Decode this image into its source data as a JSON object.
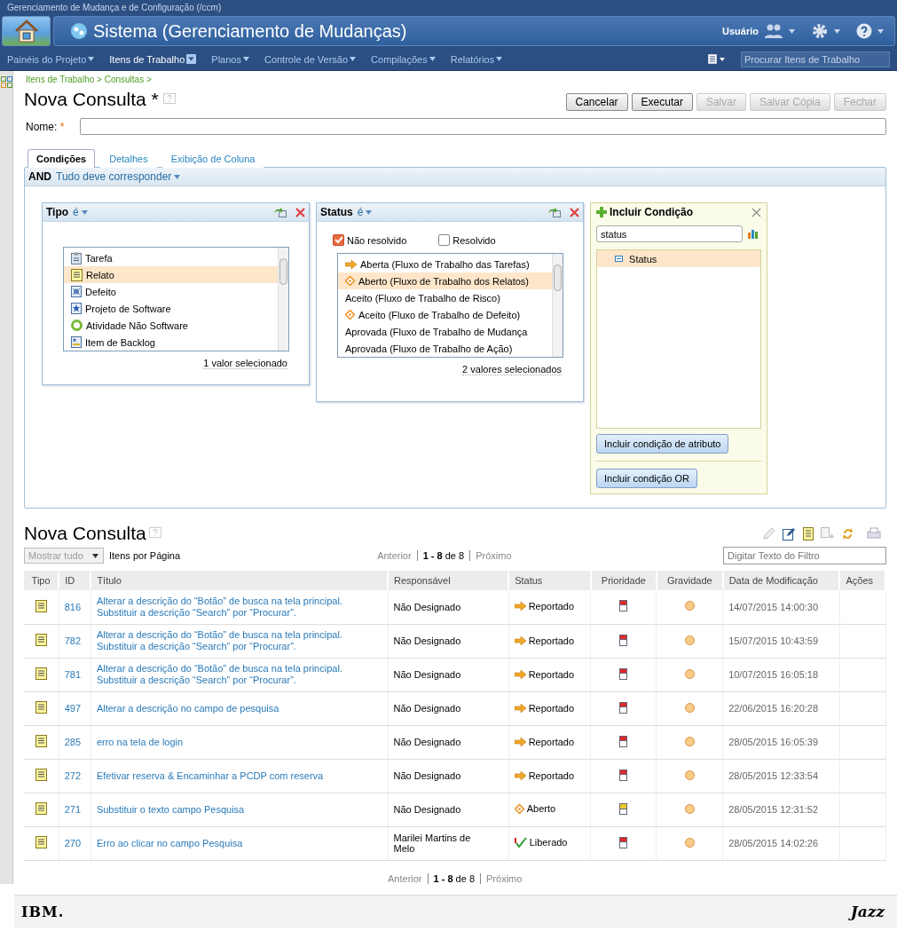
{
  "browser_title": "Gerenciamento de Mudança e de Configuração (/ccm)",
  "header": {
    "app_title": "Sistema (Gerenciamento de Mudanças)",
    "user_label": "Usuário"
  },
  "nav": {
    "items": [
      {
        "label": "Painéis do Projeto",
        "selected": false
      },
      {
        "label": "Itens de Trabalho",
        "selected": true
      },
      {
        "label": "Planos",
        "selected": false
      },
      {
        "label": "Controle de Versão",
        "selected": false
      },
      {
        "label": "Compilações",
        "selected": false
      },
      {
        "label": "Relatórios",
        "selected": false
      }
    ],
    "search_placeholder": "Procurar Itens de Trabalho"
  },
  "breadcrumb": "Itens de Trabalho > Consultas >",
  "query": {
    "title": "Nova Consulta *",
    "buttons": [
      {
        "label": "Cancelar",
        "disabled": false
      },
      {
        "label": "Executar",
        "disabled": false
      },
      {
        "label": "Salvar",
        "disabled": true
      },
      {
        "label": "Salvar Cópia",
        "disabled": true
      },
      {
        "label": "Fechar",
        "disabled": true
      }
    ],
    "name_label": "Nome:",
    "name_required": "*"
  },
  "tabs": [
    {
      "label": "Condições",
      "selected": true
    },
    {
      "label": "Detalhes",
      "selected": false
    },
    {
      "label": "Exibição de Coluna",
      "selected": false
    }
  ],
  "conditions": {
    "operator": "AND",
    "match": "Tudo deve corresponder",
    "tipo": {
      "title": "Tipo",
      "op": "é",
      "items": [
        {
          "label": "Tarefa",
          "kind": "task",
          "selected": false
        },
        {
          "label": "Relato",
          "kind": "report",
          "selected": true
        },
        {
          "label": "Defeito",
          "kind": "defect",
          "selected": false
        },
        {
          "label": "Projeto de Software",
          "kind": "project",
          "selected": false
        },
        {
          "label": "Atividade Não Software",
          "kind": "activity",
          "selected": false
        },
        {
          "label": "Item de Backlog",
          "kind": "backlog",
          "selected": false
        }
      ],
      "summary": "1 valor selecionado"
    },
    "status": {
      "title": "Status",
      "op": "é",
      "checkboxes": [
        {
          "label": "Não resolvido",
          "checked": true
        },
        {
          "label": "Resolvido",
          "checked": false
        }
      ],
      "items": [
        {
          "label": "Aberta (Fluxo de Trabalho das Tarefas)",
          "kind": "arrow",
          "selected": false
        },
        {
          "label": "Aberto (Fluxo de Trabalho dos Relatos)",
          "kind": "diamond",
          "selected": true
        },
        {
          "label": "Aceito (Fluxo de Trabalho de Risco)",
          "kind": "none",
          "selected": false
        },
        {
          "label": "Aceito (Fluxo de Trabalho de Defeito)",
          "kind": "diamond",
          "selected": false
        },
        {
          "label": "Aprovada (Fluxo de Trabalho de Mudança",
          "kind": "none",
          "selected": false
        },
        {
          "label": "Aprovada (Fluxo de Trabalho de Ação)",
          "kind": "none",
          "selected": false
        }
      ],
      "summary": "2 valores selecionados"
    },
    "add": {
      "title": "Incluir Condição",
      "search_value": "status",
      "results": [
        {
          "label": "Status",
          "selected": true
        }
      ],
      "buttons": [
        "Incluir condição de atributo",
        "Incluir condição OR"
      ]
    }
  },
  "results": {
    "title": "Nova Consulta",
    "show_all": "Mostrar tudo",
    "per_page": "Itens por Página",
    "pager": {
      "prev": "Anterior",
      "range": "1 - 8",
      "of": "de 8",
      "next": "Próximo"
    },
    "bottom_pager": {
      "prev": "Anterior",
      "range": "1 - 8",
      "of": "de 8",
      "next": "Próximo"
    },
    "filter_placeholder": "Digitar Texto do Filtro",
    "columns": [
      "Tipo",
      "ID",
      "Título",
      "Responsável",
      "Status",
      "Prioridade",
      "Gravidade",
      "Data de Modificação",
      "Ações"
    ],
    "rows": [
      {
        "id": "816",
        "title": [
          "Alterar a descrição do “Botão” de busca na tela principal.",
          "Substituir a descrição “Search” por “Procurar”."
        ],
        "owner": "Não Designado",
        "status": {
          "label": "Reportado",
          "kind": "arrow"
        },
        "priority": {
          "kind": "high"
        },
        "date": "14/07/2015 14:00:30"
      },
      {
        "id": "782",
        "title": [
          "Alterar a descrição do “Botão” de busca na tela principal.",
          "Substituir a descrição “Search” por “Procurar”."
        ],
        "owner": "Não Designado",
        "status": {
          "label": "Reportado",
          "kind": "arrow"
        },
        "priority": {
          "kind": "high"
        },
        "date": "15/07/2015 10:43:59"
      },
      {
        "id": "781",
        "title": [
          "Alterar a descrição do “Botão” de busca na tela principal.",
          "Substituir a descrição “Search” por “Procurar”."
        ],
        "owner": "Não Designado",
        "status": {
          "label": "Reportado",
          "kind": "arrow"
        },
        "priority": {
          "kind": "high"
        },
        "date": "10/07/2015 16:05:18"
      },
      {
        "id": "497",
        "title": [
          "Alterar a descrição no campo de pesquisa"
        ],
        "owner": "Não Designado",
        "status": {
          "label": "Reportado",
          "kind": "arrow"
        },
        "priority": {
          "kind": "high"
        },
        "date": "22/06/2015 16:20:28"
      },
      {
        "id": "285",
        "title": [
          "erro na tela de login"
        ],
        "owner": "Não Designado",
        "status": {
          "label": "Reportado",
          "kind": "arrow"
        },
        "priority": {
          "kind": "high"
        },
        "date": "28/05/2015 16:05:39"
      },
      {
        "id": "272",
        "title": [
          "Efetivar reserva & Encaminhar a PCDP com reserva"
        ],
        "owner": "Não Designado",
        "status": {
          "label": "Reportado",
          "kind": "arrow"
        },
        "priority": {
          "kind": "high"
        },
        "date": "28/05/2015 12:33:54"
      },
      {
        "id": "271",
        "title": [
          "Substituir o texto campo Pesquisa"
        ],
        "owner": "Não Designado",
        "status": {
          "label": "Aberto",
          "kind": "diamond"
        },
        "priority": {
          "kind": "medium"
        },
        "date": "28/05/2015 12:31:52"
      },
      {
        "id": "270",
        "title": [
          "Erro ao clicar no campo Pesquisa"
        ],
        "owner": "Marilei Martins de Melo",
        "status": {
          "label": "Liberado",
          "kind": "check"
        },
        "priority": {
          "kind": "high"
        },
        "date": "28/05/2015 14:02:26"
      }
    ]
  },
  "footer": {
    "brand": "IBM.",
    "product": "Jazz"
  }
}
